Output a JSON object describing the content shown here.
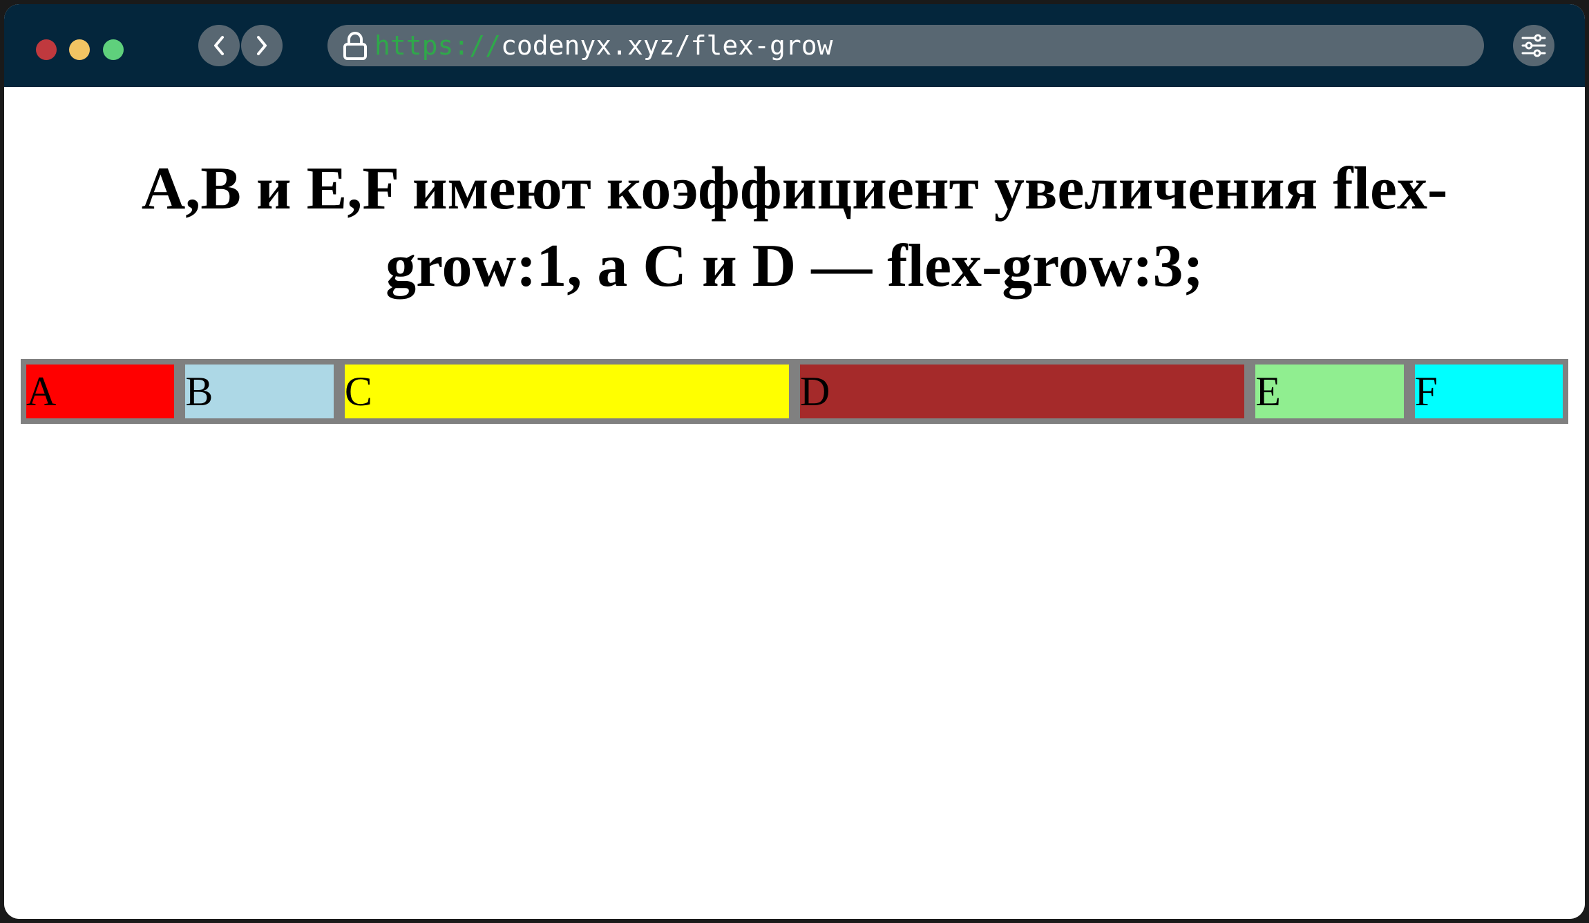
{
  "browser": {
    "window_controls": {
      "close_color": "#c0393e",
      "minimize_color": "#f2c463",
      "maximize_color": "#5fd07c"
    },
    "back_icon": "chevron-left-icon",
    "forward_icon": "chevron-right-icon",
    "lock_icon": "lock-icon",
    "settings_icon": "sliders-icon",
    "url_scheme": "https://",
    "url_rest": "codenyx.xyz/flex-grow",
    "titlebar_color": "#04263c",
    "scheme_color": "#2fa84a"
  },
  "page": {
    "heading": "A,B и E,F имеют коэффициент увеличения flex-grow:1, а C и D — flex-grow:3;",
    "container_border_color": "#808080",
    "items": [
      {
        "label": "A",
        "flex_grow": 1,
        "color": "#ff0000"
      },
      {
        "label": "B",
        "flex_grow": 1,
        "color": "#add8e6"
      },
      {
        "label": "C",
        "flex_grow": 3,
        "color": "#ffff00"
      },
      {
        "label": "D",
        "flex_grow": 3,
        "color": "#a52a2a"
      },
      {
        "label": "E",
        "flex_grow": 1,
        "color": "#90ee90"
      },
      {
        "label": "F",
        "flex_grow": 1,
        "color": "#00ffff"
      }
    ]
  }
}
